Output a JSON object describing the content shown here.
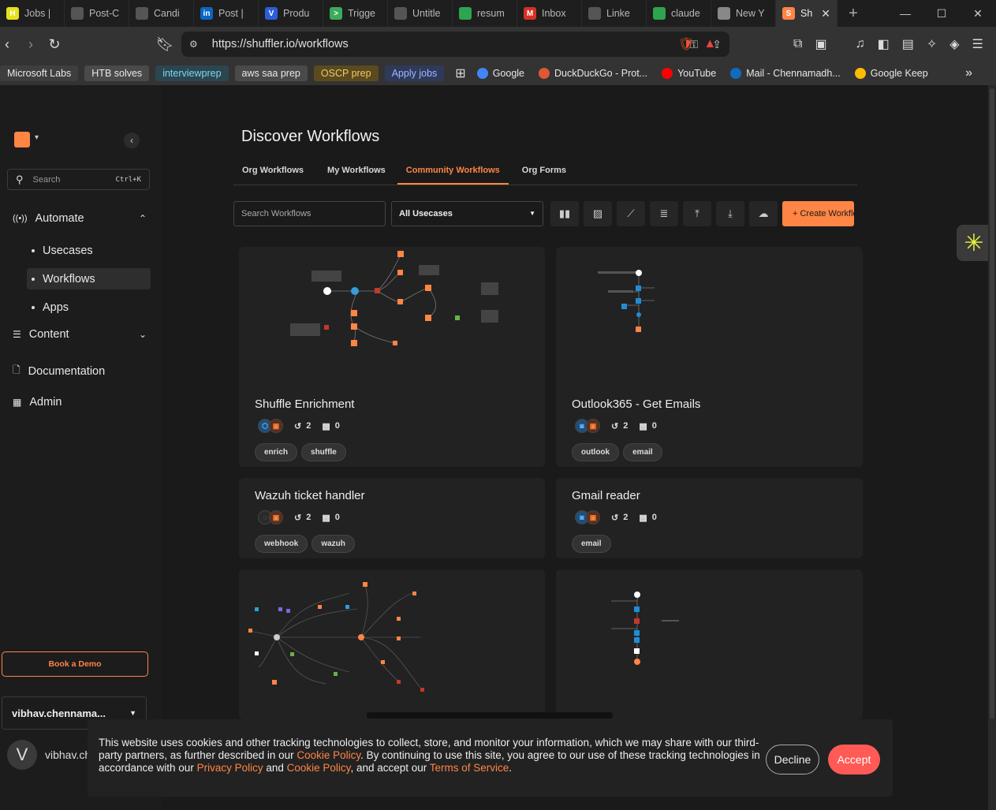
{
  "browser": {
    "tabs": [
      {
        "label": "Jobs |",
        "favicon": "H",
        "color": "#e6e21a"
      },
      {
        "label": "Post-C",
        "favicon": "globe",
        "color": "#555"
      },
      {
        "label": "Candi",
        "favicon": "globe",
        "color": "#555"
      },
      {
        "label": "Post |",
        "favicon": "in",
        "color": "#0a66c2"
      },
      {
        "label": "Produ",
        "favicon": "V",
        "color": "#2b5fd9"
      },
      {
        "label": "Trigge",
        "favicon": ">",
        "color": "#3caa5c"
      },
      {
        "label": "Untitle",
        "favicon": "tree",
        "color": "#555"
      },
      {
        "label": "resum",
        "favicon": "drive",
        "color": "#2da44e"
      },
      {
        "label": "Inbox",
        "favicon": "M",
        "color": "#d93025"
      },
      {
        "label": "Linke",
        "favicon": "gpt",
        "color": "#555"
      },
      {
        "label": "claude",
        "favicon": "drive",
        "color": "#2da44e"
      },
      {
        "label": "New Y",
        "favicon": "face",
        "color": "#888"
      },
      {
        "label": "Sh",
        "favicon": "S",
        "color": "#ff8544",
        "active": true
      }
    ],
    "url": "https://shuffler.io/workflows",
    "bookmarks": {
      "chips": [
        {
          "label": "Microsoft Labs",
          "bg": "#3e3e3e",
          "fg": "#e8e8e8"
        },
        {
          "label": "HTB solves",
          "bg": "#4a4a4a",
          "fg": "#e8e8e8"
        },
        {
          "label": "interviewprep",
          "bg": "#2c4650",
          "fg": "#7fd6f2"
        },
        {
          "label": "aws saa prep",
          "bg": "#4a4a4a",
          "fg": "#e8e8e8"
        },
        {
          "label": "OSCP prep",
          "bg": "#5a4a1e",
          "fg": "#f0c96a"
        },
        {
          "label": "Apply jobs",
          "bg": "#2f3a5a",
          "fg": "#9db8ff"
        }
      ],
      "links": [
        {
          "label": "Google",
          "color": "#4285f4"
        },
        {
          "label": "DuckDuckGo - Prot...",
          "color": "#de5833"
        },
        {
          "label": "YouTube",
          "color": "#ff0000"
        },
        {
          "label": "Mail - Chennamadh...",
          "color": "#0f6cbd"
        },
        {
          "label": "Google Keep",
          "color": "#fbbc04"
        }
      ]
    }
  },
  "sidebar": {
    "search_placeholder": "Search",
    "search_shortcut": "Ctrl+K",
    "automate": "Automate",
    "usecases": "Usecases",
    "workflows": "Workflows",
    "apps": "Apps",
    "content": "Content",
    "documentation": "Documentation",
    "admin": "Admin",
    "book_demo": "Book a Demo",
    "org": "vibhav.chennama...",
    "user_initial": "V",
    "user_name": "vibhav.ch"
  },
  "main": {
    "title": "Discover Workflows",
    "tabs": [
      "Org Workflows",
      "My Workflows",
      "Community Workflows",
      "Org Forms"
    ],
    "active_tab": 2,
    "search_placeholder": "Search Workflows",
    "usecase_select": "All Usecases",
    "create_button": "Create Workflow"
  },
  "cards": [
    {
      "title": "Shuffle Enrichment",
      "runs": "2",
      "nodes": "0",
      "tags": [
        "enrich",
        "shuffle"
      ]
    },
    {
      "title": "Outlook365 - Get Emails",
      "runs": "2",
      "nodes": "0",
      "tags": [
        "outlook",
        "email"
      ]
    },
    {
      "title": "Wazuh ticket handler",
      "runs": "2",
      "nodes": "0",
      "tags": [
        "webhook",
        "wazuh"
      ]
    },
    {
      "title": "Gmail reader",
      "runs": "2",
      "nodes": "0",
      "tags": [
        "email"
      ]
    }
  ],
  "cookie": {
    "text1": "This website uses cookies and other tracking technologies to collect, store, and monitor your information, which we may share with our third-party partners, as further described in our ",
    "link1": "Cookie Policy",
    "text2": ". By continuing to use this site, you agree to our use of these tracking technologies in accordance with our ",
    "link2": "Privacy Policy",
    "text3": " and ",
    "link3": "Cookie Policy",
    "text4": ", and accept our ",
    "link4": "Terms of Service",
    "text5": ".",
    "decline": "Decline",
    "accept": "Accept"
  },
  "colors": {
    "accent": "#ff8544",
    "accept": "#ff5a55"
  }
}
